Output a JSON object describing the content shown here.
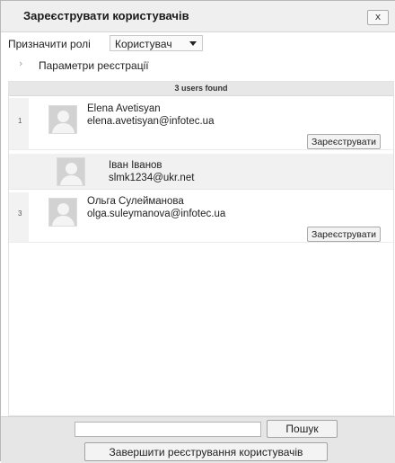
{
  "dialog": {
    "title": "Зареєструвати користувачів",
    "close_label": "x"
  },
  "role": {
    "label": "Призначити ролі",
    "selected": "Користувач"
  },
  "options": {
    "label": "Параметри реєстрації"
  },
  "results": {
    "summary": "3 users found",
    "users": [
      {
        "index": "1",
        "name": "Elena Avetisyan",
        "email": "elena.avetisyan@infotec.ua",
        "enrol_label": "Зареєструвати"
      },
      {
        "index": "",
        "name": "Іван Іванов",
        "email": "slmk1234@ukr.net",
        "enrol_label": ""
      },
      {
        "index": "3",
        "name": "Ольга Сулейманова",
        "email": "olga.suleymanova@infotec.ua",
        "enrol_label": "Зареєструвати"
      }
    ]
  },
  "footer": {
    "search_value": "",
    "search_label": "Пошук",
    "finish_label": "Завершити реєстрування користувачів"
  }
}
